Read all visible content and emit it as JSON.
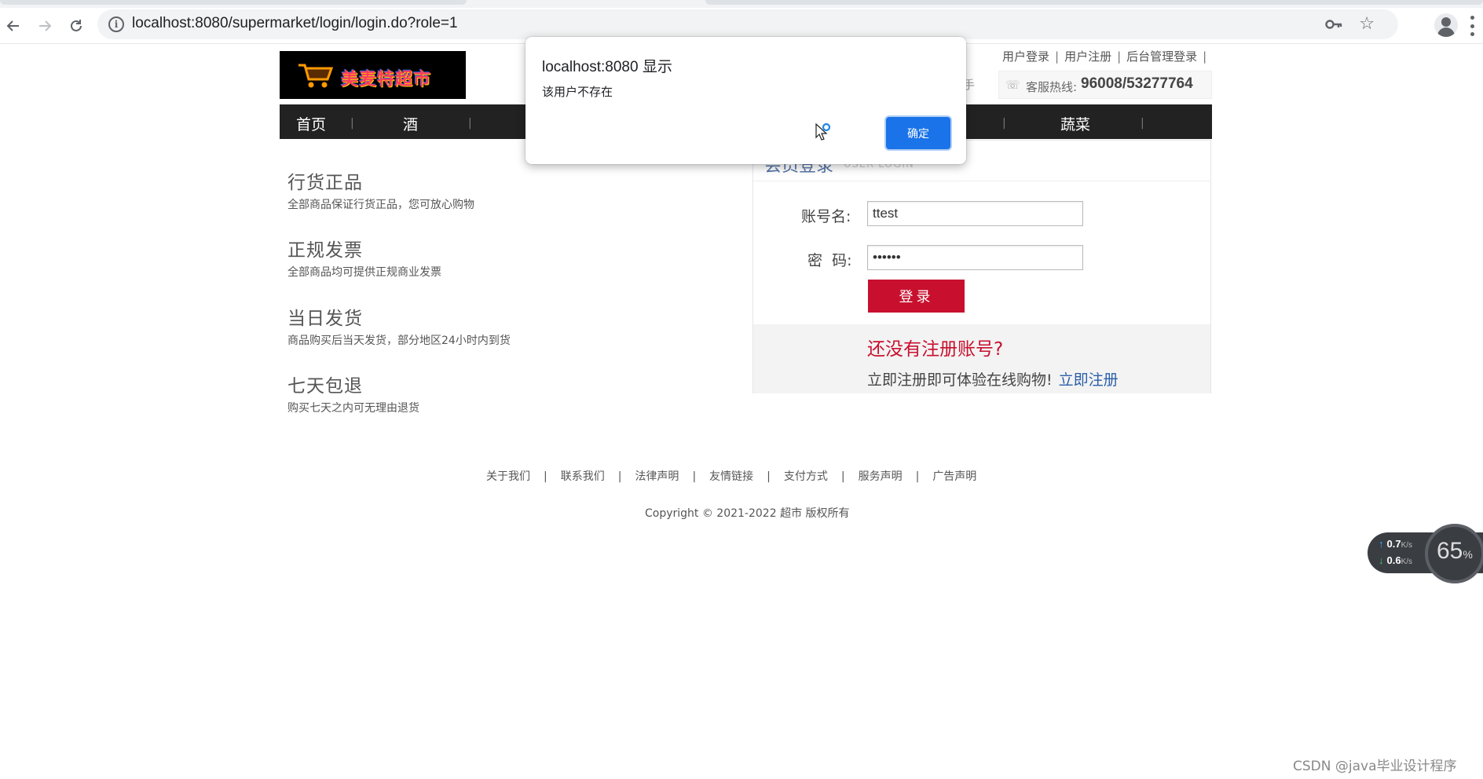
{
  "browser": {
    "url": "localhost:8080/supermarket/login/login.do?role=1",
    "icons": [
      "back-arrow-icon",
      "forward-arrow-icon",
      "reload-icon",
      "info-icon",
      "key-icon",
      "star-icon",
      "profile-icon",
      "more-icon"
    ]
  },
  "header": {
    "logo_text": "美麦特超市",
    "top_links": [
      "用户登录",
      "用户注册",
      "后台管理登录"
    ],
    "top_links_trailing_sep": "|",
    "partial_text": "手",
    "hotline_label": "客服热线:",
    "hotline_number": "96008/53277764"
  },
  "nav": {
    "items": [
      "首页",
      "酒",
      "蔬菜"
    ],
    "separator": "|"
  },
  "features": [
    {
      "title": "行货正品",
      "desc": "全部商品保证行货正品，您可放心购物"
    },
    {
      "title": "正规发票",
      "desc": "全部商品均可提供正规商业发票"
    },
    {
      "title": "当日发货",
      "desc": "商品购买后当天发货，部分地区24小时内到货"
    },
    {
      "title": "七天包退",
      "desc": "购买七天之内可无理由退货"
    }
  ],
  "login": {
    "title": "会员登录",
    "subtitle": "USER LOGIN",
    "username_label": "账号名:",
    "username_value": "ttest",
    "password_label": "密  码:",
    "password_value": "••••••",
    "submit_label": "登录",
    "register_question": "还没有注册账号?",
    "register_tip": "立即注册即可体验在线购物!",
    "register_link": "立即注册"
  },
  "footer": {
    "links": [
      "关于我们",
      "联系我们",
      "法律声明",
      "友情链接",
      "支付方式",
      "服务声明",
      "广告声明"
    ],
    "separator": "|",
    "copyright": "Copyright © 2021-2022 超市 版权所有"
  },
  "dialog": {
    "title": "localhost:8080 显示",
    "message": "该用户不存在",
    "ok_label": "确定"
  },
  "network_widget": {
    "up": "0.7",
    "down": "0.6",
    "unit": "K/s",
    "gauge": "65",
    "gauge_unit": "%"
  },
  "watermark": "CSDN @java毕业设计程序",
  "colors": {
    "brand_red": "#c8102e",
    "link_blue": "#2a5ea8",
    "dialog_blue": "#1a73e8",
    "nav_bg": "#222222"
  }
}
